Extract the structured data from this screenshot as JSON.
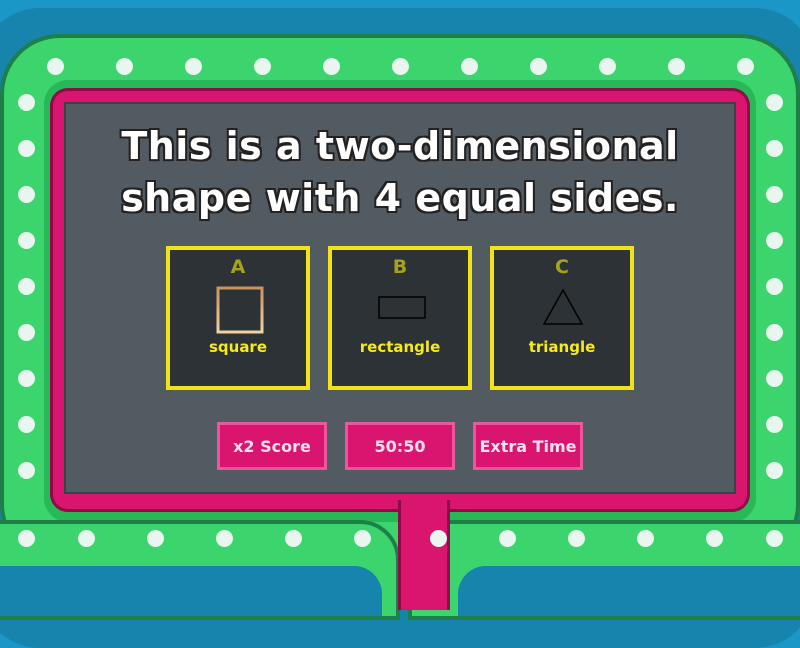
{
  "question": {
    "text": "This is a two-dimensional shape with 4 equal sides."
  },
  "answers": [
    {
      "letter": "A",
      "label": "square",
      "shape": "square-icon"
    },
    {
      "letter": "B",
      "label": "rectangle",
      "shape": "rectangle-icon"
    },
    {
      "letter": "C",
      "label": "triangle",
      "shape": "triangle-icon"
    }
  ],
  "powerups": [
    {
      "label": "x2 Score"
    },
    {
      "label": "50:50"
    },
    {
      "label": "Extra Time"
    }
  ],
  "colors": {
    "answer_border": "#f2e319",
    "answer_text": "#f7ea1a",
    "powerup_bg": "#d9156f",
    "board_bg": "#535b62",
    "frame_green": "#3bd46d",
    "frame_pink": "#d9156f"
  }
}
